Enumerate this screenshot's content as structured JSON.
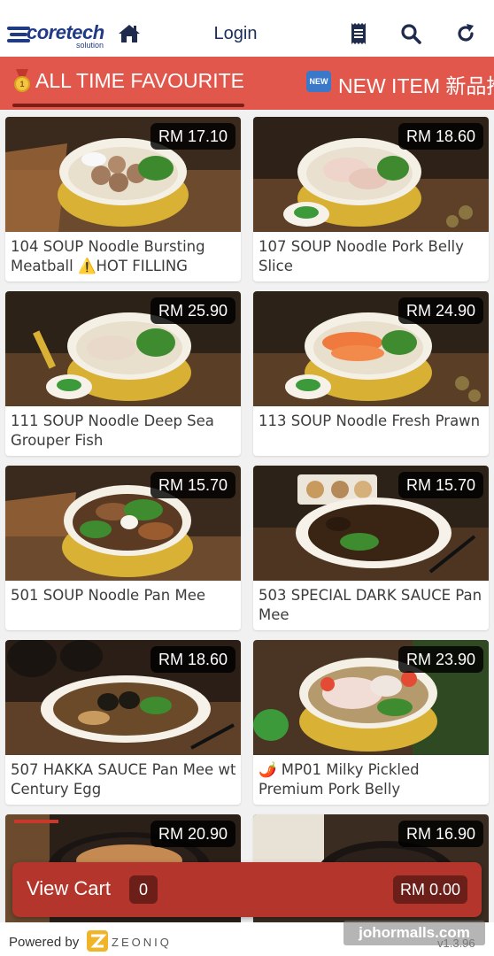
{
  "header": {
    "logo_word": "coretech",
    "logo_sub": "solution",
    "home_icon": "home-icon",
    "login_label": "Login",
    "receipt_icon": "receipt-icon",
    "search_icon": "search-icon",
    "refresh_icon": "refresh-icon"
  },
  "tabs": [
    {
      "label": "ALL TIME FAVOURITE",
      "emoji": "1",
      "active": true
    },
    {
      "label": "NEW ITEM 新品推",
      "badge": "NEW",
      "active": false
    }
  ],
  "products": [
    {
      "price": "RM 17.10",
      "name": "104 SOUP Noodle Bursting Meatball ⚠️HOT FILLING"
    },
    {
      "price": "RM 18.60",
      "name": "107 SOUP Noodle Pork Belly Slice"
    },
    {
      "price": "RM 25.90",
      "name": "111 SOUP Noodle Deep Sea Grouper Fish"
    },
    {
      "price": "RM 24.90",
      "name": "113 SOUP Noodle Fresh Prawn"
    },
    {
      "price": "RM 15.70",
      "name": "501 SOUP Noodle Pan Mee"
    },
    {
      "price": "RM 15.70",
      "name": "503 SPECIAL DARK SAUCE Pan Mee"
    },
    {
      "price": "RM 18.60",
      "name": "507 HAKKA SAUCE Pan Mee wt Century Egg"
    },
    {
      "price": "RM 23.90",
      "name": "🌶️ MP01 Milky Pickled Premium Pork Belly"
    },
    {
      "price": "RM 20.90",
      "name": ""
    },
    {
      "price": "RM 16.90",
      "name": ""
    }
  ],
  "cart": {
    "label": "View Cart",
    "count": "0",
    "total": "RM 0.00"
  },
  "footer": {
    "powered_by": "Powered by",
    "brand": "ZEONIQ",
    "version": "v1.3.96"
  },
  "watermark": "johormalls.com",
  "colors": {
    "accent": "#e2574c",
    "cart": "#b3352b",
    "brand_blue": "#213a86"
  }
}
